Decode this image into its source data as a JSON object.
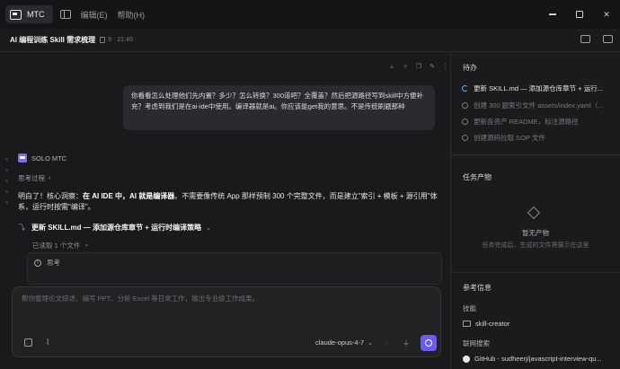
{
  "app": {
    "name": "MTC",
    "menu": [
      "编辑(E)",
      "帮助(H)"
    ]
  },
  "header": {
    "task_title": "AI 编程训练 Skill 需求梳理",
    "task_meta": "9 · 21:40"
  },
  "chat": {
    "user_message": "你看看怎么处理他们先内置？多少？怎么转换？300道吧？全覆盖？然后把源路径写到skill中方便补充？考虑到我们是在ai-ide中使用。编译器就是ai。你应该能get我的意思。不是传统刷题那种",
    "agent_name": "SOLO MTC",
    "thinking_label": "思考过程",
    "answer_prefix": "明白了！核心洞察：",
    "answer_bold1": "在 AI IDE 中，AI 就是编译器",
    "answer_rest": "。不需要像传统 App 那样预制 300 个完整文件，而是建立\"索引 + 模板 + 源引用\"体系，运行时按需\"编译\"。",
    "step_label": "更新 SKILL.md — 添加源仓库章节 + 运行时编译策略",
    "read_label": "已读取 1 个文件",
    "think_card_label": "思考"
  },
  "composer": {
    "placeholder": "帮你整理论文综述、编写 PPT、分析 Excel 等日常工作，输出专业级工作成果。",
    "model": "claude-opus-4-7"
  },
  "right_panel": {
    "todo_title": "待办",
    "todos": [
      {
        "label": "更新 SKILL.md — 添加源仓库章节 + 运行...",
        "active": true
      },
      {
        "label": "创建 300 题索引文件 assets/index.yaml（...",
        "active": false
      },
      {
        "label": "更新各资产 README，标注源路径",
        "active": false
      },
      {
        "label": "创建源码拉取 SOP 文件",
        "active": false
      }
    ],
    "output_title": "任务产物",
    "empty_title": "暂无产物",
    "empty_sub": "任务完成后，生成的文件将展示在这里",
    "ref_title": "参考信息",
    "skills_label": "技能",
    "skill_item": "skill-creator",
    "web_label": "联网搜索",
    "web_item": "GitHub - sudheerj/javascript-interview-qu..."
  }
}
